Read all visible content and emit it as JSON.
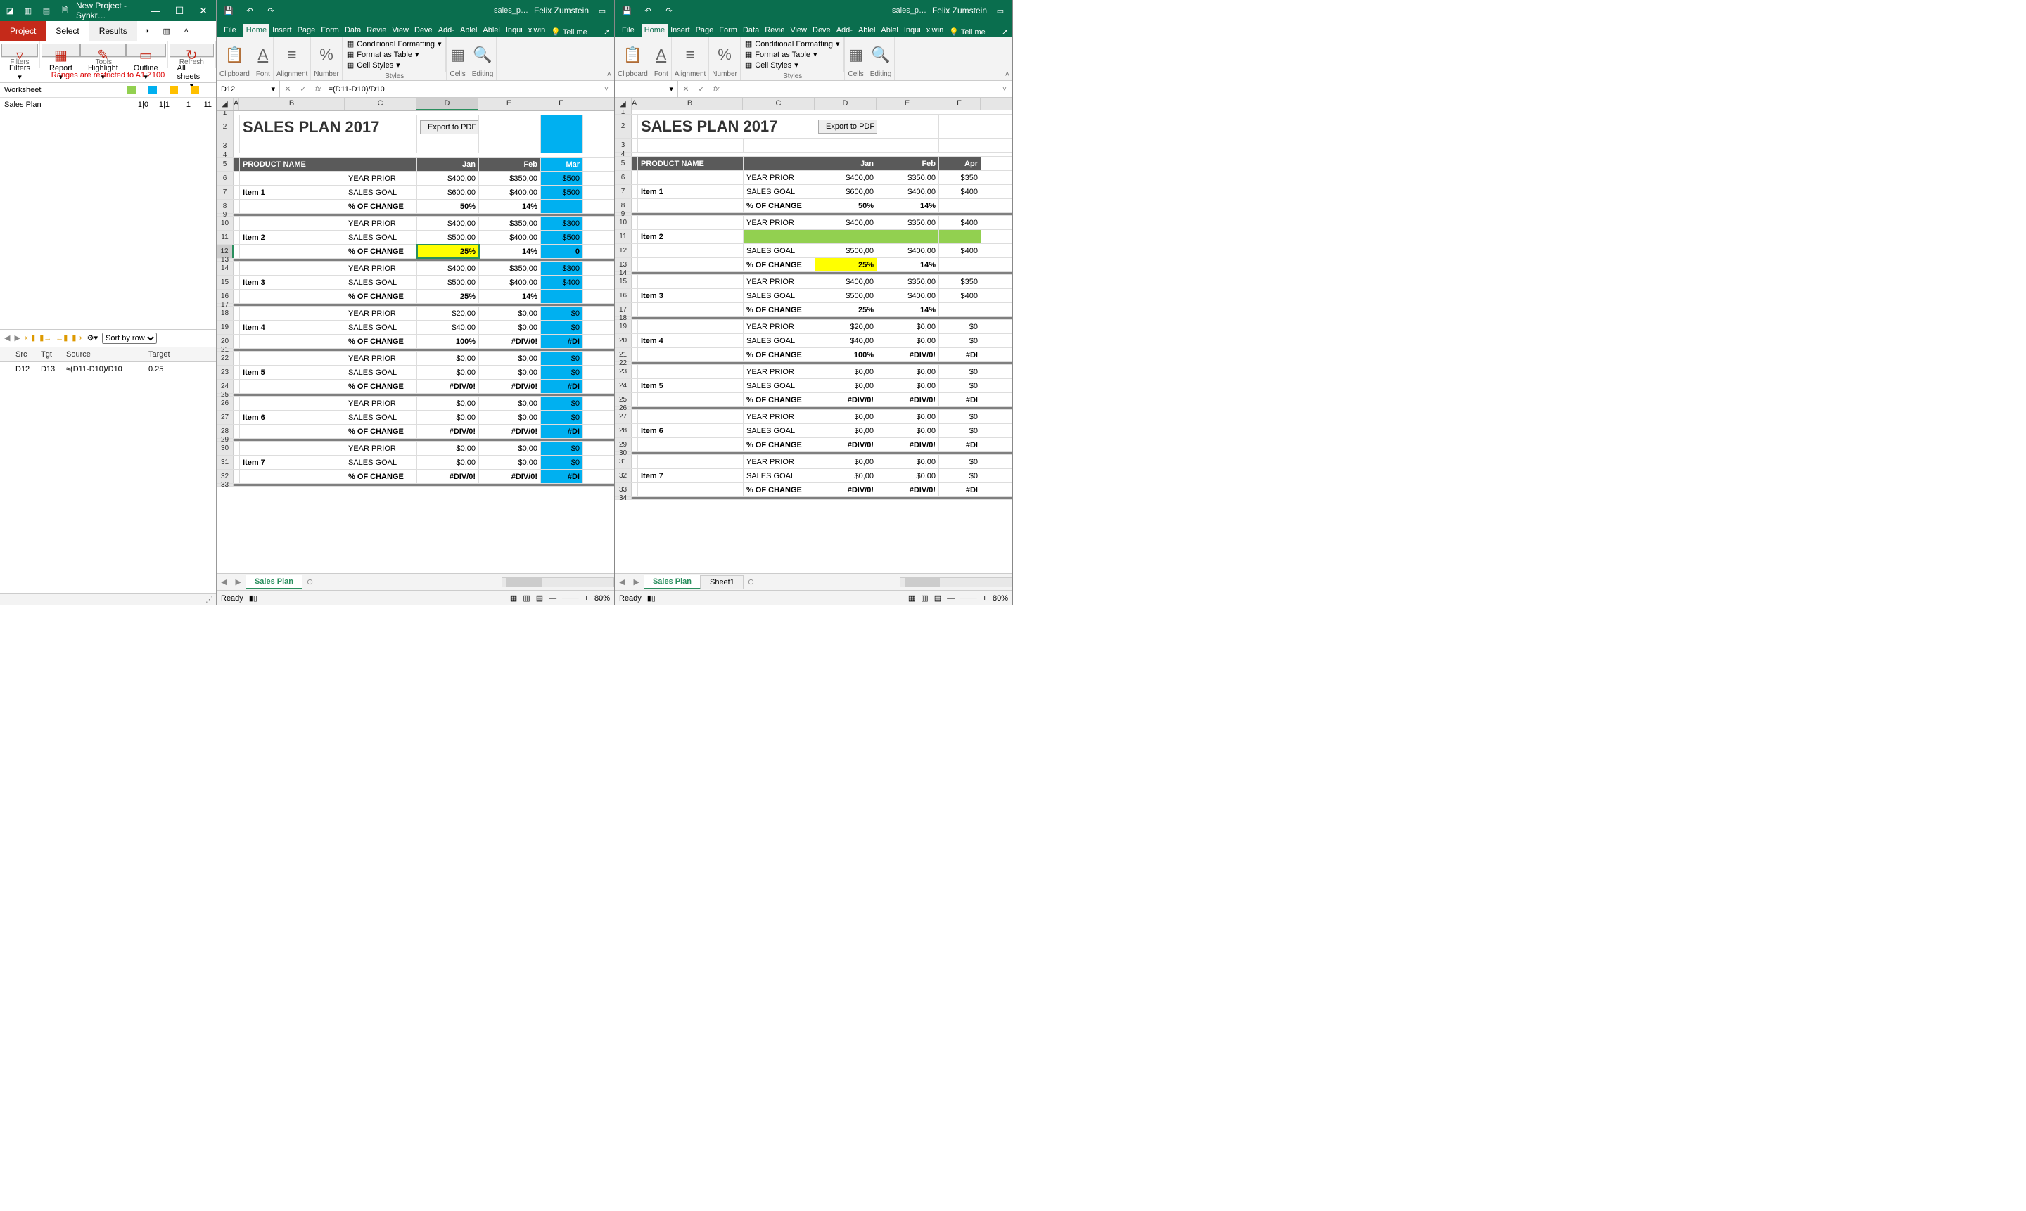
{
  "left": {
    "title": "New Project - Synkr…",
    "tabs": {
      "project": "Project",
      "select": "Select",
      "results": "Results"
    },
    "ribbon": {
      "filters_btn": "Filters",
      "report": "Report",
      "highlight": "Highlight",
      "outline": "Outline",
      "allsheets": "All sheets",
      "grp_filters": "Filters",
      "grp_tools": "Tools",
      "grp_refresh": "Refresh"
    },
    "warn": "Ranges are restricted to A1:Z100",
    "wsh": {
      "h": "Worksheet",
      "row": "Sales Plan",
      "c1": "1|0",
      "c2": "1|1",
      "c3": "1",
      "c4": "11"
    },
    "sort": "Sort by row",
    "diffh": {
      "src": "Src",
      "tgt": "Tgt",
      "source": "Source",
      "target": "Target"
    },
    "diffr": {
      "src": "D12",
      "tgt": "D13",
      "source": "≈(D11-D10)/D10",
      "target": "0.25"
    }
  },
  "ex": {
    "save_tip": "Save",
    "undo_tip": "Undo",
    "redo_tip": "Redo",
    "file": "sales_p…",
    "user": "Felix Zumstein",
    "tabs": [
      "File",
      "Home",
      "Insert",
      "Page",
      "Form",
      "Data",
      "Revie",
      "View",
      "Deve",
      "Add-",
      "Ablel",
      "Ablel",
      "Inqui",
      "xlwin"
    ],
    "tellme": "Tell me",
    "rb": {
      "clipboard": "Clipboard",
      "font": "Font",
      "alignment": "Alignment",
      "number": "Number",
      "styles": "Styles",
      "cells": "Cells",
      "editing": "Editing",
      "cf": "Conditional Formatting",
      "ft": "Format as Table",
      "cs": "Cell Styles"
    },
    "namebox": "D12",
    "formula": "=(D11-D10)/D10",
    "ready": "Ready",
    "zoom": "80%",
    "sheet": "Sales Plan",
    "sheet2": "Sheet1",
    "title": "SALES PLAN 2017",
    "export": "Export to PDF",
    "cols": {
      "a": "A",
      "b": "B",
      "c": "C",
      "d": "D",
      "e": "E",
      "f1": "F",
      "f2": "F"
    },
    "months1": [
      "Jan",
      "Feb",
      "Mar"
    ],
    "months2": [
      "Jan",
      "Feb",
      "Apr"
    ],
    "ph": "PRODUCT NAME",
    "rlab": {
      "yp": "YEAR PRIOR",
      "sg": "SALES GOAL",
      "pc": "% OF CHANGE"
    },
    "items": {
      "1": {
        "n": "Item 1",
        "yp": [
          "$400,00",
          "$350,00",
          "$500"
        ],
        "sg": [
          "$600,00",
          "$400,00",
          "$500"
        ],
        "pc": [
          "50%",
          "14%",
          ""
        ]
      },
      "2": {
        "n": "Item 2",
        "yp": [
          "$400,00",
          "$350,00",
          "$300"
        ],
        "sg": [
          "$500,00",
          "$400,00",
          "$500"
        ],
        "pc": [
          "25%",
          "14%",
          "0"
        ]
      },
      "3": {
        "n": "Item 3",
        "yp": [
          "$400,00",
          "$350,00",
          "$300"
        ],
        "sg": [
          "$500,00",
          "$400,00",
          "$400"
        ],
        "pc": [
          "25%",
          "14%",
          ""
        ]
      },
      "4": {
        "n": "Item 4",
        "yp": [
          "$20,00",
          "$0,00",
          "$0"
        ],
        "sg": [
          "$40,00",
          "$0,00",
          "$0"
        ],
        "pc": [
          "100%",
          "#DIV/0!",
          "#DI"
        ]
      },
      "5": {
        "n": "Item 5",
        "yp": [
          "$0,00",
          "$0,00",
          "$0"
        ],
        "sg": [
          "$0,00",
          "$0,00",
          "$0"
        ],
        "pc": [
          "#DIV/0!",
          "#DIV/0!",
          "#DI"
        ]
      },
      "6": {
        "n": "Item 6",
        "yp": [
          "$0,00",
          "$0,00",
          "$0"
        ],
        "sg": [
          "$0,00",
          "$0,00",
          "$0"
        ],
        "pc": [
          "#DIV/0!",
          "#DIV/0!",
          "#DI"
        ]
      },
      "7": {
        "n": "Item 7",
        "yp": [
          "$0,00",
          "$0,00",
          "$0"
        ],
        "sg": [
          "$0,00",
          "$0,00",
          "$0"
        ],
        "pc": [
          "#DIV/0!",
          "#DIV/0!",
          "#DI"
        ]
      }
    },
    "items2": {
      "1": {
        "n": "Item 1",
        "yp": [
          "$400,00",
          "$350,00",
          "$350"
        ],
        "sg": [
          "$600,00",
          "$400,00",
          "$400"
        ],
        "pc": [
          "50%",
          "14%",
          ""
        ]
      },
      "2": {
        "n": "Item 2",
        "yp": [
          "$400,00",
          "$350,00",
          "$400"
        ],
        "sg": [
          "$500,00",
          "$400,00",
          "$400"
        ],
        "pc": [
          "25%",
          "14%",
          ""
        ]
      },
      "3": {
        "n": "Item 3",
        "yp": [
          "$400,00",
          "$350,00",
          "$350"
        ],
        "sg": [
          "$500,00",
          "$400,00",
          "$400"
        ],
        "pc": [
          "25%",
          "14%",
          ""
        ]
      },
      "4": {
        "n": "Item 4",
        "yp": [
          "$20,00",
          "$0,00",
          "$0"
        ],
        "sg": [
          "$40,00",
          "$0,00",
          "$0"
        ],
        "pc": [
          "100%",
          "#DIV/0!",
          "#DI"
        ]
      },
      "5": {
        "n": "Item 5",
        "yp": [
          "$0,00",
          "$0,00",
          "$0"
        ],
        "sg": [
          "$0,00",
          "$0,00",
          "$0"
        ],
        "pc": [
          "#DIV/0!",
          "#DIV/0!",
          "#DI"
        ]
      },
      "6": {
        "n": "Item 6",
        "yp": [
          "$0,00",
          "$0,00",
          "$0"
        ],
        "sg": [
          "$0,00",
          "$0,00",
          "$0"
        ],
        "pc": [
          "#DIV/0!",
          "#DIV/0!",
          "#DI"
        ]
      },
      "7": {
        "n": "Item 7",
        "yp": [
          "$0,00",
          "$0,00",
          "$0"
        ],
        "sg": [
          "$0,00",
          "$0,00",
          "$0"
        ],
        "pc": [
          "#DIV/0!",
          "#DIV/0!",
          "#DI"
        ]
      }
    },
    "rownums1": [
      1,
      2,
      3,
      4,
      5,
      6,
      7,
      8,
      9,
      10,
      11,
      12,
      13,
      14,
      15,
      16,
      17,
      18,
      19,
      20,
      21,
      22,
      23,
      24,
      25,
      26,
      27,
      28,
      29,
      30,
      31
    ],
    "rownums2": [
      1,
      2,
      3,
      4,
      5,
      6,
      7,
      8,
      9,
      10,
      11,
      12,
      13,
      14,
      15,
      16,
      17,
      18,
      19,
      20,
      21,
      22,
      23,
      24,
      25,
      26,
      27,
      28,
      29,
      30,
      31
    ]
  }
}
